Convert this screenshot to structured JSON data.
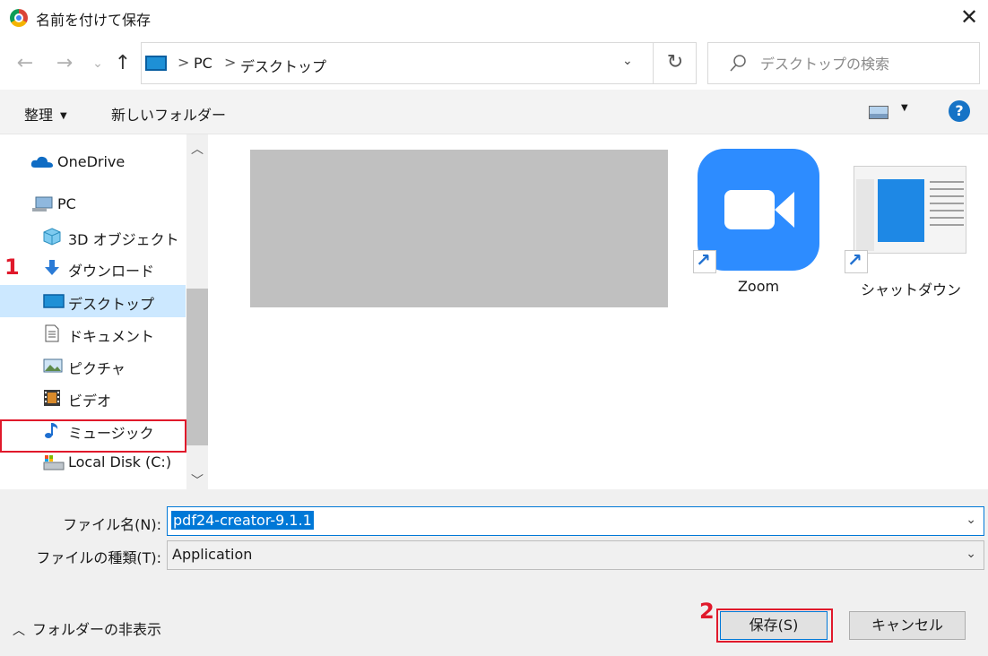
{
  "window": {
    "title": "名前を付けて保存",
    "close_glyph": "✕"
  },
  "nav": {
    "back_glyph": "←",
    "forward_glyph": "→",
    "recent_glyph": "⌄",
    "up_glyph": "↑",
    "breadcrumb": [
      "PC",
      "デスクトップ"
    ],
    "refresh_glyph": "↻",
    "search_placeholder": "デスクトップの検索"
  },
  "toolbar": {
    "organize_label": "整理",
    "new_folder_label": "新しいフォルダー",
    "help_label": "?"
  },
  "sidebar": {
    "items": [
      {
        "label": "OneDrive",
        "icon": "onedrive-icon"
      },
      {
        "label": "PC",
        "icon": "pc-icon"
      },
      {
        "label": "3D オブジェクト",
        "icon": "3d-objects-icon"
      },
      {
        "label": "ダウンロード",
        "icon": "download-icon"
      },
      {
        "label": "デスクトップ",
        "icon": "desktop-icon",
        "selected": true
      },
      {
        "label": "ドキュメント",
        "icon": "documents-icon"
      },
      {
        "label": "ピクチャ",
        "icon": "pictures-icon"
      },
      {
        "label": "ビデオ",
        "icon": "video-icon"
      },
      {
        "label": "ミュージック",
        "icon": "music-icon"
      },
      {
        "label": "Local Disk (C:)",
        "icon": "local-disk-icon"
      }
    ]
  },
  "content": {
    "files": [
      {
        "label": "Zoom",
        "icon": "zoom-icon"
      },
      {
        "label": "シャットダウン",
        "icon": "shutdown-thumbnail"
      }
    ]
  },
  "form": {
    "filename_label": "ファイル名(N):",
    "filename_value": "pdf24-creator-9.1.1",
    "filetype_label": "ファイルの種類(T):",
    "filetype_value": "Application"
  },
  "footer": {
    "hide_folders_label": "フォルダーの非表示",
    "save_label": "保存(S)",
    "cancel_label": "キャンセル"
  },
  "annotations": {
    "step1": "1",
    "step2": "2"
  },
  "colors": {
    "accent": "#0078d7",
    "highlight": "#e0192b",
    "selection": "#cce8ff"
  }
}
